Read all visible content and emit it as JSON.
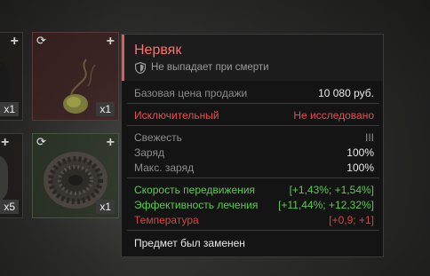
{
  "slots": [
    {
      "count": "x1",
      "plus": "+",
      "cycle": ""
    },
    {
      "count": "x1",
      "plus": "+",
      "cycle": "⟳"
    },
    {
      "count": "x5",
      "plus": "",
      "cycle": ""
    },
    {
      "count": "x1",
      "plus": "+",
      "cycle": "⟳"
    }
  ],
  "tooltip": {
    "title": "Нервяк",
    "subtitle": "Не выпадает при смерти",
    "price_label": "Базовая цена продажи",
    "price_value": "10 080 руб.",
    "rarity_label": "Исключительный",
    "research_status": "Не исследовано",
    "stats": [
      {
        "label": "Свежесть",
        "value": "III"
      },
      {
        "label": "Заряд",
        "value": "100%"
      },
      {
        "label": "Макс. заряд",
        "value": "100%"
      }
    ],
    "effects": [
      {
        "label": "Скорость передвижения",
        "value": "[+1,43%; +1,54%]",
        "tone": "positive"
      },
      {
        "label": "Эффективность лечения",
        "value": "[+11,44%; +12,32%]",
        "tone": "positive"
      },
      {
        "label": "Температура",
        "value": "[+0,9; +1]",
        "tone": "negative"
      }
    ],
    "footer": "Предмет был заменен"
  },
  "colors": {
    "accent": "#e05a5a",
    "positive": "#5fc856",
    "negative": "#d9453f"
  }
}
